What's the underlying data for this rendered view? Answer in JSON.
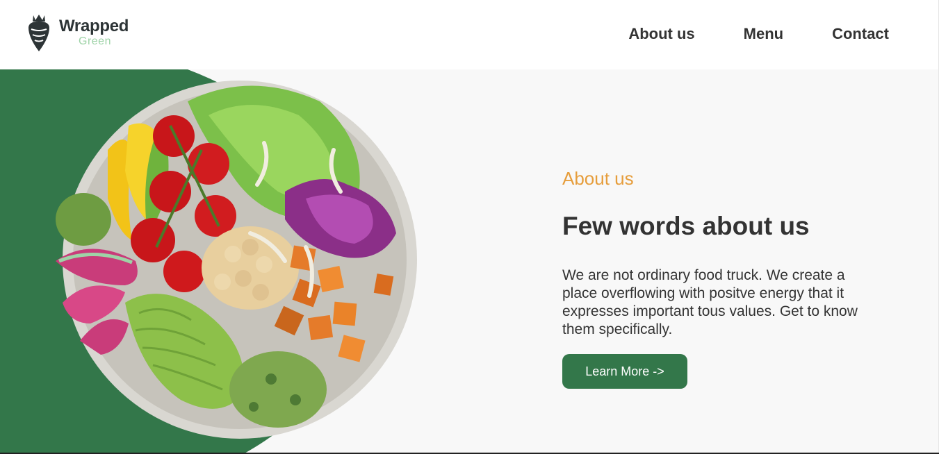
{
  "brand": {
    "name": "Wrapped",
    "sub": "Green"
  },
  "nav": {
    "items": [
      "About us",
      "Menu",
      "Contact"
    ]
  },
  "hero": {
    "eyebrow": "About us",
    "title": "Few words about us",
    "description": "We are not ordinary food truck. We create a place overflowing with positve energy that it expresses important tous values. Get to know them specifically.",
    "button": "Learn More ->"
  },
  "colors": {
    "accent_green": "#33774a",
    "eyebrow_orange": "#e69d3b",
    "logo_sub": "#9ed3a7",
    "hero_bg": "#f8f8f8"
  },
  "icons": {
    "logo": "radish-logo-icon"
  }
}
